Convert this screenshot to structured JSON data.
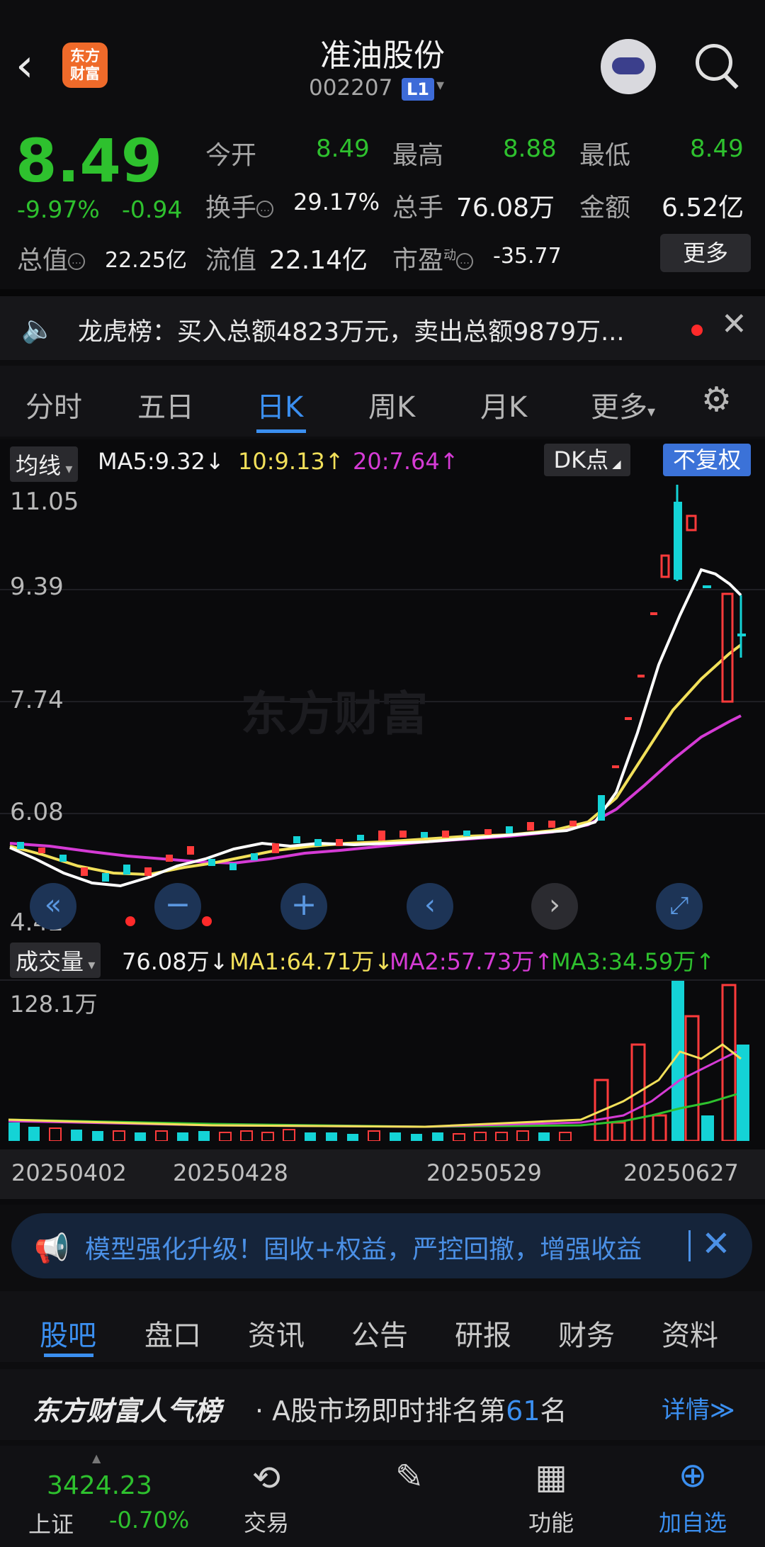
{
  "header": {
    "title": "准油股份",
    "code": "002207",
    "level": "L1",
    "logo_line1": "东方",
    "logo_line2": "财富"
  },
  "quote": {
    "price": "8.49",
    "change_pct": "-9.97%",
    "change_amt": "-0.94",
    "open_label": "今开",
    "open": "8.49",
    "high_label": "最高",
    "high": "8.88",
    "low_label": "最低",
    "low": "8.49",
    "turnover_label": "换手",
    "turnover": "29.17%",
    "volume_label": "总手",
    "volume": "76.08万",
    "amount_label": "金额",
    "amount": "6.52亿",
    "mcap_label": "总值",
    "mcap": "22.25亿",
    "float_label": "流值",
    "float_cap": "22.14亿",
    "pe_label": "市盈",
    "pe_sup": "动",
    "pe": "-35.77",
    "more_button": "更多"
  },
  "notice": {
    "text": "龙虎榜：买入总额4823万元，卖出总额9879万..."
  },
  "tabs": [
    "分时",
    "五日",
    "日K",
    "周K",
    "月K",
    "更多"
  ],
  "active_tab": "日K",
  "kline": {
    "ma_chip": "均线",
    "ma5": "MA5:9.32",
    "ma10": "10:9.13",
    "ma20": "20:7.64",
    "dk_label": "DK点",
    "adjust_label": "不复权",
    "y_labels": [
      "11.05",
      "9.39",
      "7.74",
      "6.08",
      "4.42"
    ],
    "watermark": "东方财富"
  },
  "volume_panel": {
    "chip": "成交量",
    "current": "76.08万",
    "ma1": "MA1:64.71万",
    "ma2": "MA2:57.73万",
    "ma3": "MA3:34.59万",
    "y_top": "128.1万"
  },
  "dates": [
    "20250402",
    "20250428",
    "20250529",
    "20250627"
  ],
  "ad": {
    "text": "模型强化升级！固收+权益，严控回撤，增强收益"
  },
  "bottom_tabs": [
    "股吧",
    "盘口",
    "资讯",
    "公告",
    "研报",
    "财务",
    "资料"
  ],
  "rank": {
    "brand": "东方财富人气榜",
    "text_prefix": "· A股市场即时排名第",
    "rank_num": "61",
    "text_suffix": "名",
    "more": "详情≫"
  },
  "bottom_nav": {
    "index_value": "3424.23",
    "index_name": "上证",
    "index_change": "-0.70%",
    "trade": "交易",
    "function": "功能",
    "add_watch": "加自选"
  },
  "colors": {
    "up": "#ff3b3b",
    "down": "#2ec12e",
    "accent": "#3b8ff0",
    "ma5": "#ffffff",
    "ma10": "#f2e05a",
    "ma20": "#d53bd5"
  }
}
